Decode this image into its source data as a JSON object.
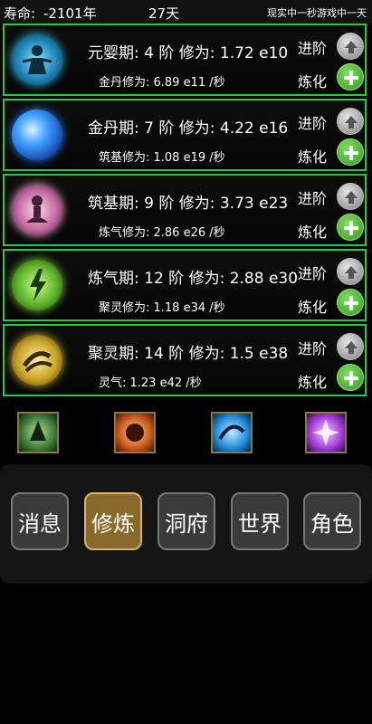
{
  "status": {
    "lifespan_label": "寿命:",
    "lifespan_value": "-2101年",
    "days": "27天",
    "time_note": "现实中一秒游戏中一天"
  },
  "stages": [
    {
      "title": "元婴期: 4 阶 修为: 1.72 e10",
      "rate": "金丹修为: 6.89 e11 /秒",
      "advance": "进阶",
      "refine": "炼化",
      "icon": "spirit-figure-icon",
      "icon_color": "#2fb6d8"
    },
    {
      "title": "金丹期: 7 阶 修为: 4.22 e16",
      "rate": "筑基修为: 1.08 e19 /秒",
      "advance": "进阶",
      "refine": "炼化",
      "icon": "blue-orb-icon",
      "icon_color": "#2f7fe8"
    },
    {
      "title": "筑基期: 9 阶 修为: 3.73 e23",
      "rate": "炼气修为: 2.86 e26 /秒",
      "advance": "进阶",
      "refine": "炼化",
      "icon": "meditating-figure-icon",
      "icon_color": "#e7a6c8"
    },
    {
      "title": "炼气期: 12 阶 修为: 2.88 e30",
      "rate": "聚灵修为: 1.18 e34 /秒",
      "advance": "进阶",
      "refine": "炼化",
      "icon": "green-lightning-icon",
      "icon_color": "#74d23a"
    },
    {
      "title": "聚灵期: 14 阶 修为: 1.5 e38",
      "rate": "灵气: 1.23 e42 /秒",
      "advance": "进阶",
      "refine": "炼化",
      "icon": "golden-swirl-icon",
      "icon_color": "#d2b23a"
    }
  ],
  "skills": [
    {
      "label": "炼气",
      "icon": "qi-refining-icon",
      "color": "#3f7a3a"
    },
    {
      "label": "炼体",
      "icon": "body-refining-icon",
      "color": "#c9561e"
    },
    {
      "label": "潜能",
      "icon": "potential-icon",
      "color": "#1f8ad8"
    },
    {
      "label": "魂力",
      "icon": "soul-power-icon",
      "color": "#a33bd8"
    }
  ],
  "nav": [
    {
      "label": "消息",
      "active": false
    },
    {
      "label": "修炼",
      "active": true
    },
    {
      "label": "洞府",
      "active": false
    },
    {
      "label": "世界",
      "active": false
    },
    {
      "label": "角色",
      "active": false
    }
  ]
}
